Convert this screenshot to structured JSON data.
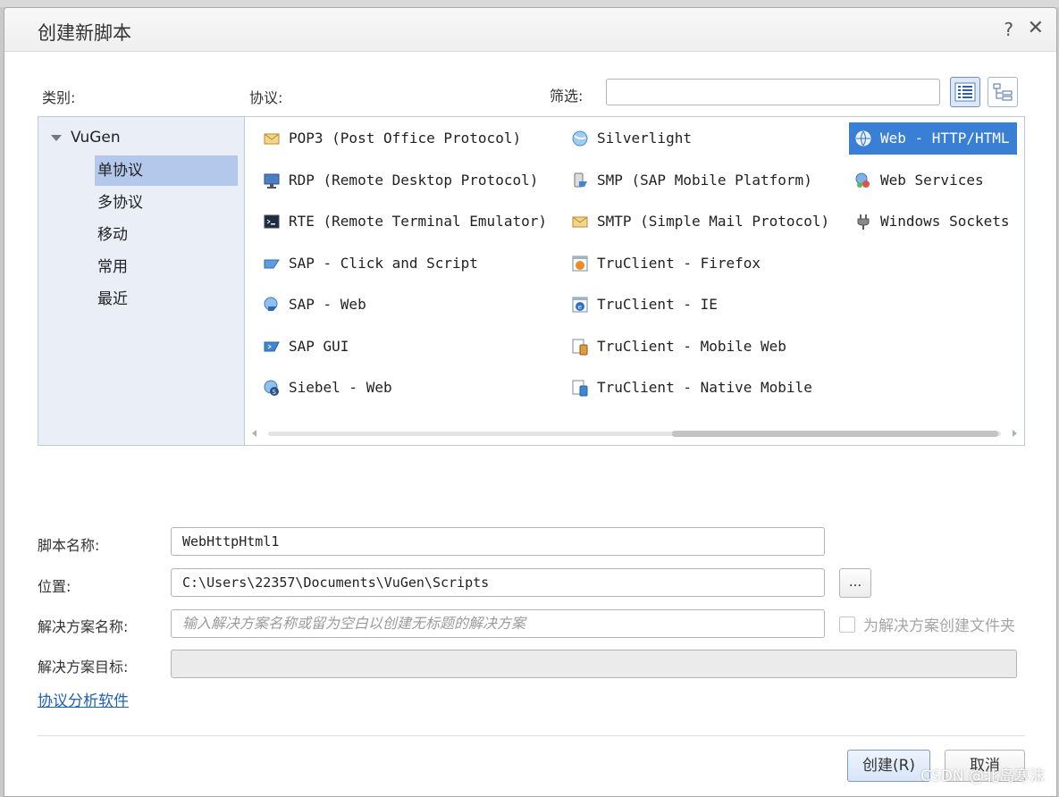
{
  "dialog": {
    "title": "创建新脚本",
    "help": "?",
    "close": "✕"
  },
  "labels": {
    "category": "类别:",
    "protocol": "协议:",
    "filter": "筛选:"
  },
  "filter": {
    "value": ""
  },
  "categories": {
    "root": "VuGen",
    "items": [
      "单协议",
      "多协议",
      "移动",
      "常用",
      "最近"
    ],
    "selected": "单协议"
  },
  "protocols": {
    "col1": [
      {
        "label": "POP3 (Post Office Protocol)",
        "icon": "mail-icon"
      },
      {
        "label": "RDP (Remote Desktop Protocol)",
        "icon": "monitor-icon"
      },
      {
        "label": "RTE (Remote Terminal Emulator)",
        "icon": "terminal-icon"
      },
      {
        "label": "SAP - Click and Script",
        "icon": "sap-click-icon"
      },
      {
        "label": "SAP - Web",
        "icon": "sap-web-icon"
      },
      {
        "label": "SAP GUI",
        "icon": "sap-gui-icon"
      },
      {
        "label": "Siebel - Web",
        "icon": "siebel-icon"
      }
    ],
    "col2": [
      {
        "label": "Silverlight",
        "icon": "silverlight-icon"
      },
      {
        "label": "SMP (SAP Mobile Platform)",
        "icon": "mobile-platform-icon"
      },
      {
        "label": "SMTP (Simple Mail Protocol)",
        "icon": "mail-icon"
      },
      {
        "label": "TruClient - Firefox",
        "icon": "truclient-firefox-icon"
      },
      {
        "label": "TruClient - IE",
        "icon": "truclient-ie-icon"
      },
      {
        "label": "TruClient - Mobile Web",
        "icon": "truclient-mobile-icon"
      },
      {
        "label": "TruClient - Native Mobile",
        "icon": "truclient-native-icon"
      }
    ],
    "col3": [
      {
        "label": "Web - HTTP/HTML",
        "icon": "globe-icon"
      },
      {
        "label": "Web Services",
        "icon": "web-services-icon"
      },
      {
        "label": "Windows Sockets",
        "icon": "plug-icon"
      }
    ],
    "selected": "Web - HTTP/HTML"
  },
  "form": {
    "script_name_label": "脚本名称:",
    "script_name": "WebHttpHtml1",
    "location_label": "位置:",
    "location": "C:\\Users\\22357\\Documents\\VuGen\\Scripts",
    "browse": "...",
    "solution_name_label": "解决方案名称:",
    "solution_name_placeholder": "输入解决方案名称或留为空白以创建无标题的解决方案",
    "create_folder_label": "为解决方案创建文件夹",
    "solution_target_label": "解决方案目标:",
    "solution_target": ""
  },
  "link": "协议分析软件",
  "buttons": {
    "create": "创建(R)",
    "cancel": "取消"
  },
  "watermark": "CSDN @北岛寒沫",
  "colors": {
    "selection": "#3a7fd6",
    "category_selected": "#b4c8ec",
    "link": "#1f5fb8"
  }
}
